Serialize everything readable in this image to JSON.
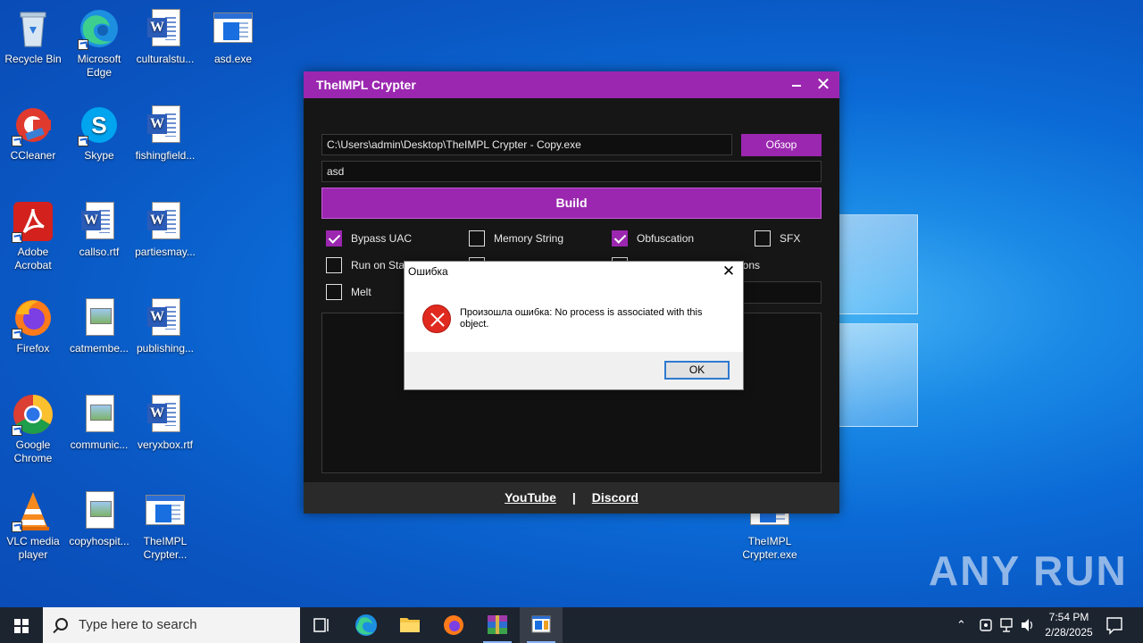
{
  "desktop": {
    "icons": [
      {
        "label": "Recycle Bin"
      },
      {
        "label": "Microsoft Edge"
      },
      {
        "label": "culturalstu..."
      },
      {
        "label": "asd.exe"
      },
      {
        "label": "CCleaner"
      },
      {
        "label": "Skype"
      },
      {
        "label": "fishingfield..."
      },
      {
        "label": "Adobe Acrobat"
      },
      {
        "label": "callso.rtf"
      },
      {
        "label": "partiesmay..."
      },
      {
        "label": "Firefox"
      },
      {
        "label": "catmembe..."
      },
      {
        "label": "publishing..."
      },
      {
        "label": "Google Chrome"
      },
      {
        "label": "communic..."
      },
      {
        "label": "veryxbox.rtf"
      },
      {
        "label": "VLC media player"
      },
      {
        "label": "copyhospit..."
      },
      {
        "label": "TheIMPL Crypter..."
      },
      {
        "label": "TheIMPL Crypter.exe"
      }
    ]
  },
  "crypter": {
    "title": "TheIMPL Crypter",
    "path_value": "C:\\Users\\admin\\Desktop\\TheIMPL Crypter - Copy.exe",
    "browse_label": "Обзор",
    "name_value": "asd",
    "build_label": "Build",
    "options": [
      {
        "label": "Bypass UAC",
        "checked": true
      },
      {
        "label": "Memory String",
        "checked": false
      },
      {
        "label": "Obfuscation",
        "checked": true
      },
      {
        "label": "SFX",
        "checked": false
      },
      {
        "label": "Run on Sta",
        "checked": false
      },
      {
        "label": "sions",
        "checked": false
      },
      {
        "label": "Melt",
        "checked": false
      }
    ],
    "footer": {
      "youtube": "YouTube",
      "separator": "|",
      "discord": "Discord"
    }
  },
  "dialog": {
    "title": "Ошибка",
    "message": "Произошла ошибка: No process is associated with this object.",
    "ok_label": "OK"
  },
  "watermark": "ANY RUN",
  "taskbar": {
    "search_placeholder": "Type here to search",
    "time": "7:54 PM",
    "date": "2/28/2025"
  },
  "colors": {
    "accent": "#9b27b0",
    "taskbar": "#1c2430"
  }
}
